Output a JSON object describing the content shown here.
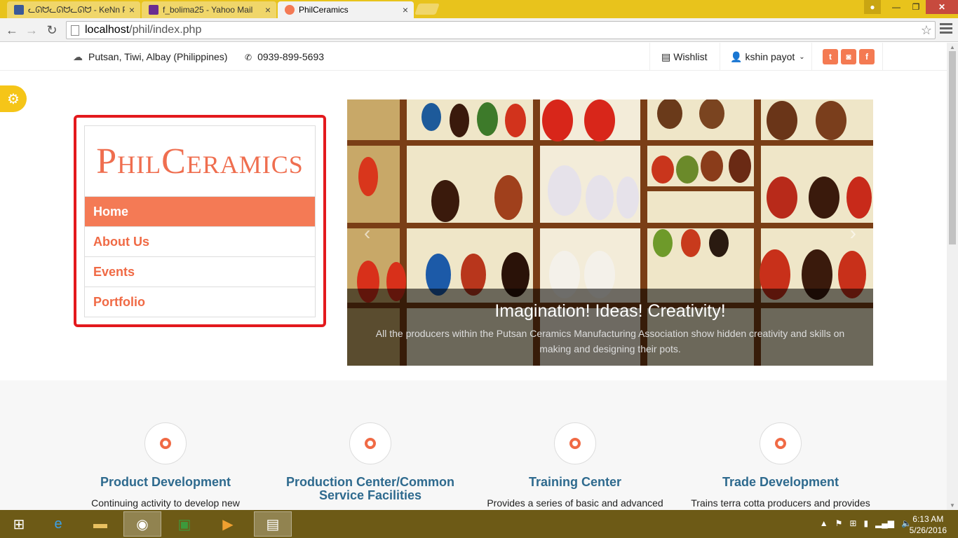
{
  "browser": {
    "tabs": [
      {
        "title": "ᓚᘏᗢᓚᘏᗢᓚᘏᗢ - KeNn P Ta",
        "favicon_color": "#3b5998"
      },
      {
        "title": "f_bolima25 - Yahoo Mail",
        "favicon_color": "#6a2c91"
      },
      {
        "title": "PhilCeramics",
        "favicon_color": "#f47a55"
      }
    ],
    "url_host": "localhost",
    "url_path": "/phil/index.php"
  },
  "topbar": {
    "location": "Putsan, Tiwi, Albay (Philippines)",
    "phone": "0939-899-5693",
    "wishlist": "Wishlist",
    "user": "kshin payot",
    "social": [
      "twitter",
      "instagram",
      "facebook"
    ]
  },
  "sidebar": {
    "logo": "PhilCeramics",
    "items": [
      "Home",
      "About Us",
      "Events",
      "Portfolio"
    ],
    "active_index": 0
  },
  "slider": {
    "title": "Imagination! Ideas! Creativity!",
    "text": "All the producers within the Putsan Ceramics Manufacturing Association show hidden creativity and skills on making and designing their pots."
  },
  "features": [
    {
      "title": "Product Development",
      "text": "Continuing activity to develop new"
    },
    {
      "title": "Production Center/Common Service Facilities",
      "text": ""
    },
    {
      "title": "Training Center",
      "text": "Provides a series of basic and advanced"
    },
    {
      "title": "Trade Development",
      "text": "Trains terra cotta producers and provides"
    }
  ],
  "taskbar": {
    "time": "6:13 AM",
    "date": "5/26/2016"
  },
  "colors": {
    "accent": "#f47a55",
    "feature_title": "#2e6a8e",
    "highlight_border": "#e3191d",
    "chrome": "#e8c31c"
  }
}
